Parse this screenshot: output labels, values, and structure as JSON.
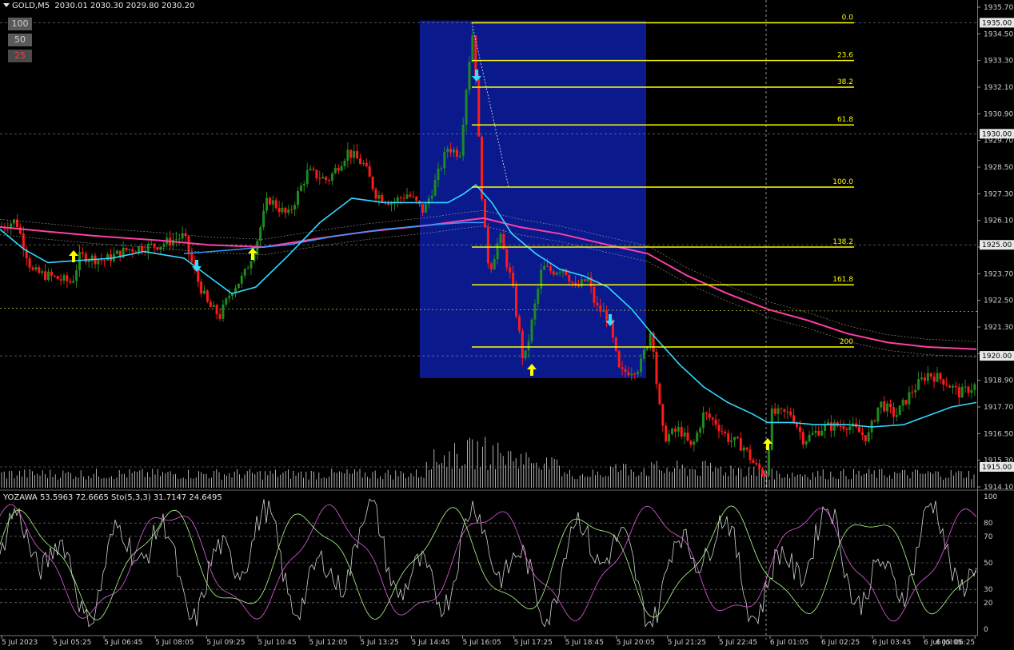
{
  "header": {
    "symbol_timeframe": "GOLD,M5",
    "ohlc": "2030.01 2030.30 2029.80 2030.20"
  },
  "buttons": [
    "100",
    "50",
    "25"
  ],
  "sub_window": {
    "label": "YOZAWA 53.5963 72.6665  Sto(5,3,3) 31.7147 24.6495"
  },
  "price_axis": {
    "labels": [
      "1935.70",
      "1934.50",
      "1933.30",
      "1932.10",
      "1930.90",
      "1929.70",
      "1928.50",
      "1927.30",
      "1926.10",
      "1924.90",
      "1923.70",
      "1922.50",
      "1921.30",
      "1920.10",
      "1918.90",
      "1917.70",
      "1916.50",
      "1915.30",
      "1914.10"
    ],
    "boxed": [
      "1935.00",
      "1930.00",
      "1925.00",
      "1920.00",
      "1915.00"
    ]
  },
  "osc_axis": {
    "labels": [
      "100",
      "80",
      "70",
      "50",
      "30",
      "20",
      "0"
    ]
  },
  "time_axis": {
    "labels": [
      "5 Jul 2023",
      "5 Jul 05:25",
      "5 Jul 06:45",
      "5 Jul 08:05",
      "5 Jul 09:25",
      "5 Jul 10:45",
      "5 Jul 12:05",
      "5 Jul 13:25",
      "5 Jul 14:45",
      "5 Jul 16:05",
      "5 Jul 17:25",
      "5 Jul 18:45",
      "5 Jul 20:05",
      "5 Jul 21:25",
      "5 Jul 22:45",
      "6 Jul 01:05",
      "6 Jul 02:25",
      "6 Jul 03:45",
      "6 Jul 05:05",
      "6 Jul 06:25"
    ]
  },
  "fibonacci": {
    "levels": [
      "0.0",
      "23.6",
      "38.2",
      "61.8",
      "100.0",
      "138.2",
      "161.8",
      "200"
    ],
    "prices": [
      1935.0,
      1933.3,
      1932.1,
      1930.4,
      1927.6,
      1924.9,
      1923.2,
      1920.4
    ],
    "color": "#ffff00"
  },
  "colors": {
    "background": "#000000",
    "bull": "#1f8a1f",
    "bear": "#ff1a1a",
    "ma_fast": "#33d6ff",
    "ma_slow": "#ff3fa6",
    "ma_mid": "#3399ff",
    "highlight_box": "#0a1a8c",
    "arrow_up": "#ffff00",
    "arrow_down": "#33ddff",
    "volume": "#d8d8d8",
    "grid": "#9a9a9a"
  },
  "chart_data": {
    "type": "candlestick",
    "price_range": [
      1914.1,
      1935.7
    ],
    "osc_range": [
      0,
      100
    ],
    "osc_levels": [
      80,
      70,
      50,
      30,
      20
    ],
    "fast_ma": [
      [
        0,
        1925.7
      ],
      [
        30,
        1924.8
      ],
      [
        60,
        1924.2
      ],
      [
        100,
        1924.3
      ],
      [
        140,
        1924.4
      ],
      [
        180,
        1924.7
      ],
      [
        230,
        1924.4
      ],
      [
        260,
        1923.6
      ],
      [
        290,
        1922.8
      ],
      [
        320,
        1923.1
      ],
      [
        360,
        1924.5
      ],
      [
        400,
        1926.0
      ],
      [
        440,
        1927.1
      ],
      [
        480,
        1926.9
      ],
      [
        520,
        1926.9
      ],
      [
        560,
        1926.9
      ],
      [
        580,
        1927.3
      ],
      [
        595,
        1927.7
      ],
      [
        615,
        1926.9
      ],
      [
        640,
        1925.5
      ],
      [
        670,
        1924.6
      ],
      [
        700,
        1923.9
      ],
      [
        730,
        1923.6
      ],
      [
        760,
        1923.1
      ],
      [
        790,
        1922.1
      ],
      [
        820,
        1920.8
      ],
      [
        850,
        1919.6
      ],
      [
        880,
        1918.6
      ],
      [
        910,
        1917.9
      ],
      [
        940,
        1917.4
      ],
      [
        960,
        1917.0
      ],
      [
        990,
        1917.0
      ],
      [
        1020,
        1916.9
      ],
      [
        1060,
        1916.9
      ],
      [
        1090,
        1916.8
      ],
      [
        1130,
        1916.9
      ],
      [
        1160,
        1917.3
      ],
      [
        1190,
        1917.7
      ],
      [
        1221,
        1917.9
      ]
    ],
    "slow_ma": [
      [
        0,
        1925.8
      ],
      [
        60,
        1925.6
      ],
      [
        120,
        1925.4
      ],
      [
        200,
        1925.2
      ],
      [
        260,
        1925.0
      ],
      [
        330,
        1924.9
      ],
      [
        400,
        1925.3
      ],
      [
        460,
        1925.6
      ],
      [
        540,
        1925.9
      ],
      [
        580,
        1926.1
      ],
      [
        605,
        1926.2
      ],
      [
        650,
        1925.8
      ],
      [
        700,
        1925.5
      ],
      [
        760,
        1925.0
      ],
      [
        810,
        1924.6
      ],
      [
        860,
        1923.6
      ],
      [
        910,
        1922.8
      ],
      [
        960,
        1922.1
      ],
      [
        1010,
        1921.6
      ],
      [
        1060,
        1921.0
      ],
      [
        1110,
        1920.6
      ],
      [
        1160,
        1920.4
      ],
      [
        1221,
        1920.3
      ]
    ]
  }
}
